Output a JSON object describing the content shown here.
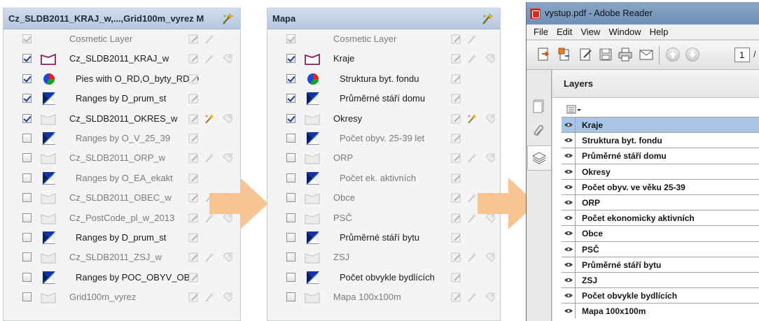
{
  "panel1": {
    "title": "Cz_SLDB2011_KRAJ_w,...,Grid100m_vyrez M",
    "layers": [
      {
        "name": "Cosmetic Layer",
        "checked": true,
        "dim": true,
        "symbol": "none",
        "sub": false
      },
      {
        "name": "Cz_SLDB2011_KRAJ_w",
        "checked": true,
        "dim": false,
        "symbol": "region-frame-icon",
        "sub": false
      },
      {
        "name": "Pies with O_RD,O_byty_RD,O",
        "checked": true,
        "dim": false,
        "symbol": "pie-chart-icon",
        "sub": true
      },
      {
        "name": "Ranges by D_prum_st",
        "checked": true,
        "dim": false,
        "symbol": "range-theme-icon",
        "sub": true
      },
      {
        "name": "Cz_SLDB2011_OKRES_w",
        "checked": true,
        "dim": false,
        "symbol": "region-frame-grey-icon",
        "sub": false
      },
      {
        "name": "Ranges by O_V_25_39",
        "checked": false,
        "dim": true,
        "symbol": "range-theme-icon",
        "sub": true
      },
      {
        "name": "Cz_SLDB2011_ORP_w",
        "checked": false,
        "dim": true,
        "symbol": "region-frame-grey-icon",
        "sub": false
      },
      {
        "name": "Ranges by O_EA_ekakt",
        "checked": false,
        "dim": true,
        "symbol": "range-theme-icon",
        "sub": true
      },
      {
        "name": "Cz_SLDB2011_OBEC_w",
        "checked": false,
        "dim": true,
        "symbol": "region-frame-grey-icon",
        "sub": false
      },
      {
        "name": "Cz_PostCode_pl_w_2013",
        "checked": false,
        "dim": true,
        "symbol": "region-frame-grey-icon",
        "sub": false
      },
      {
        "name": "Ranges by D_prum_st",
        "checked": false,
        "dim": false,
        "symbol": "range-theme-icon",
        "sub": true
      },
      {
        "name": "Cz_SLDB2011_ZSJ_w",
        "checked": false,
        "dim": true,
        "symbol": "region-frame-grey-icon",
        "sub": false
      },
      {
        "name": "Ranges by POC_OBYV_OBV",
        "checked": false,
        "dim": false,
        "symbol": "range-theme-icon",
        "sub": true
      },
      {
        "name": "Grid100m_vyrez",
        "checked": false,
        "dim": true,
        "symbol": "region-frame-grey-icon",
        "sub": false
      }
    ]
  },
  "panel2": {
    "title": "Mapa",
    "layers": [
      {
        "name": "Cosmetic Layer",
        "checked": true,
        "dim": true,
        "symbol": "none",
        "sub": false
      },
      {
        "name": "Kraje",
        "checked": true,
        "dim": false,
        "symbol": "region-frame-icon",
        "sub": false
      },
      {
        "name": "Struktura byt. fondu",
        "checked": true,
        "dim": false,
        "symbol": "pie-chart-icon",
        "sub": true
      },
      {
        "name": "Průměrné stáří domu",
        "checked": true,
        "dim": false,
        "symbol": "range-theme-icon",
        "sub": true
      },
      {
        "name": "Okresy",
        "checked": true,
        "dim": false,
        "symbol": "region-frame-grey-icon",
        "sub": false
      },
      {
        "name": "Počet obyv. 25-39 let",
        "checked": false,
        "dim": true,
        "symbol": "range-theme-icon",
        "sub": true
      },
      {
        "name": "ORP",
        "checked": false,
        "dim": true,
        "symbol": "region-frame-grey-icon",
        "sub": false
      },
      {
        "name": "Počet ek. aktivních",
        "checked": false,
        "dim": true,
        "symbol": "range-theme-icon",
        "sub": true
      },
      {
        "name": "Obce",
        "checked": false,
        "dim": true,
        "symbol": "region-frame-grey-icon",
        "sub": false
      },
      {
        "name": "PSČ",
        "checked": false,
        "dim": true,
        "symbol": "region-frame-grey-icon",
        "sub": false
      },
      {
        "name": "Průměrné stáří bytu",
        "checked": false,
        "dim": false,
        "symbol": "range-theme-icon",
        "sub": true
      },
      {
        "name": "ZSJ",
        "checked": false,
        "dim": true,
        "symbol": "region-frame-grey-icon",
        "sub": false
      },
      {
        "name": "Počet obvykle bydlících",
        "checked": false,
        "dim": false,
        "symbol": "range-theme-icon",
        "sub": true
      },
      {
        "name": "Mapa 100x100m",
        "checked": false,
        "dim": true,
        "symbol": "region-frame-grey-icon",
        "sub": false
      }
    ]
  },
  "reader": {
    "window_title": "vystup.pdf - Adobe Reader",
    "menu": [
      "File",
      "Edit",
      "View",
      "Window",
      "Help"
    ],
    "page_number": "1",
    "page_slash": "/",
    "layers_title": "Layers",
    "pdf_layers": [
      "Kraje",
      "Struktura byt. fondu",
      "Průměrné stáří domu",
      "Okresy",
      "Počet obyv. ve věku 25-39",
      "ORP",
      "Počet ekonomicky aktivních",
      "Obce",
      "PSČ",
      "Průměrné stáří bytu",
      "ZSJ",
      "Počet obvykle bydlících",
      "Mapa 100x100m"
    ],
    "selected_index": 0
  },
  "colors": {
    "panel_header": "#b7c9df",
    "arrow": "#f6c08a",
    "selection": "#a9c5e6",
    "titlebar": "#7b9abf"
  }
}
